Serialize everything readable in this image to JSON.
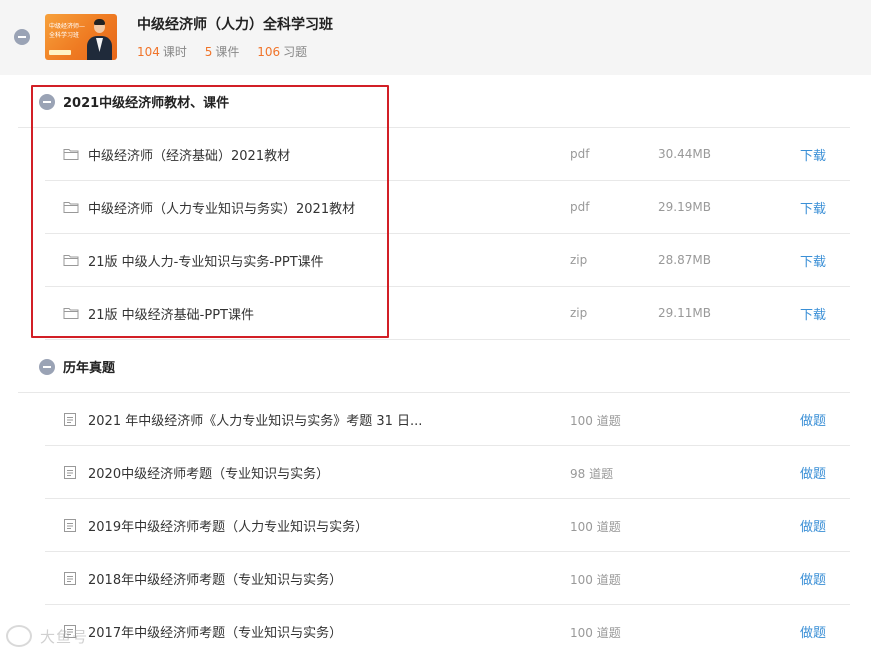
{
  "course": {
    "title": "中级经济师（人力）全科学习班",
    "thumbnail": {
      "line1": "中级经济师—",
      "line2": "全科学习班"
    },
    "stats": [
      {
        "value": "104",
        "unit": "课时"
      },
      {
        "value": "5",
        "unit": "课件"
      },
      {
        "value": "106",
        "unit": "习题"
      }
    ]
  },
  "sections": [
    {
      "title": "2021中级经济师教材、课件",
      "items": [
        {
          "name": "中级经济师（经济基础）2021教材",
          "type": "pdf",
          "size": "30.44MB",
          "action": "下载"
        },
        {
          "name": "中级经济师（人力专业知识与务实）2021教材",
          "type": "pdf",
          "size": "29.19MB",
          "action": "下载"
        },
        {
          "name": "21版 中级人力-专业知识与实务-PPT课件",
          "type": "zip",
          "size": "28.87MB",
          "action": "下载"
        },
        {
          "name": "21版 中级经济基础-PPT课件",
          "type": "zip",
          "size": "29.11MB",
          "action": "下载"
        }
      ]
    },
    {
      "title": "历年真题",
      "items": [
        {
          "name": "2021 年中级经济师《人力专业知识与实务》考题 31 日...",
          "count": "100 道题",
          "action": "做题"
        },
        {
          "name": "2020中级经济师考题（专业知识与实务）",
          "count": "98 道题",
          "action": "做题"
        },
        {
          "name": "2019年中级经济师考题（人力专业知识与实务）",
          "count": "100 道题",
          "action": "做题"
        },
        {
          "name": "2018年中级经济师考题（专业知识与实务）",
          "count": "100 道题",
          "action": "做题"
        },
        {
          "name": "2017年中级经济师考题（专业知识与实务）",
          "count": "100 道题",
          "action": "做题"
        }
      ]
    }
  ],
  "watermark": {
    "text": "大鱼号"
  },
  "colors": {
    "accent_orange": "#f0742a",
    "link_blue": "#3a8fd6",
    "highlight_red": "#d21f26"
  }
}
